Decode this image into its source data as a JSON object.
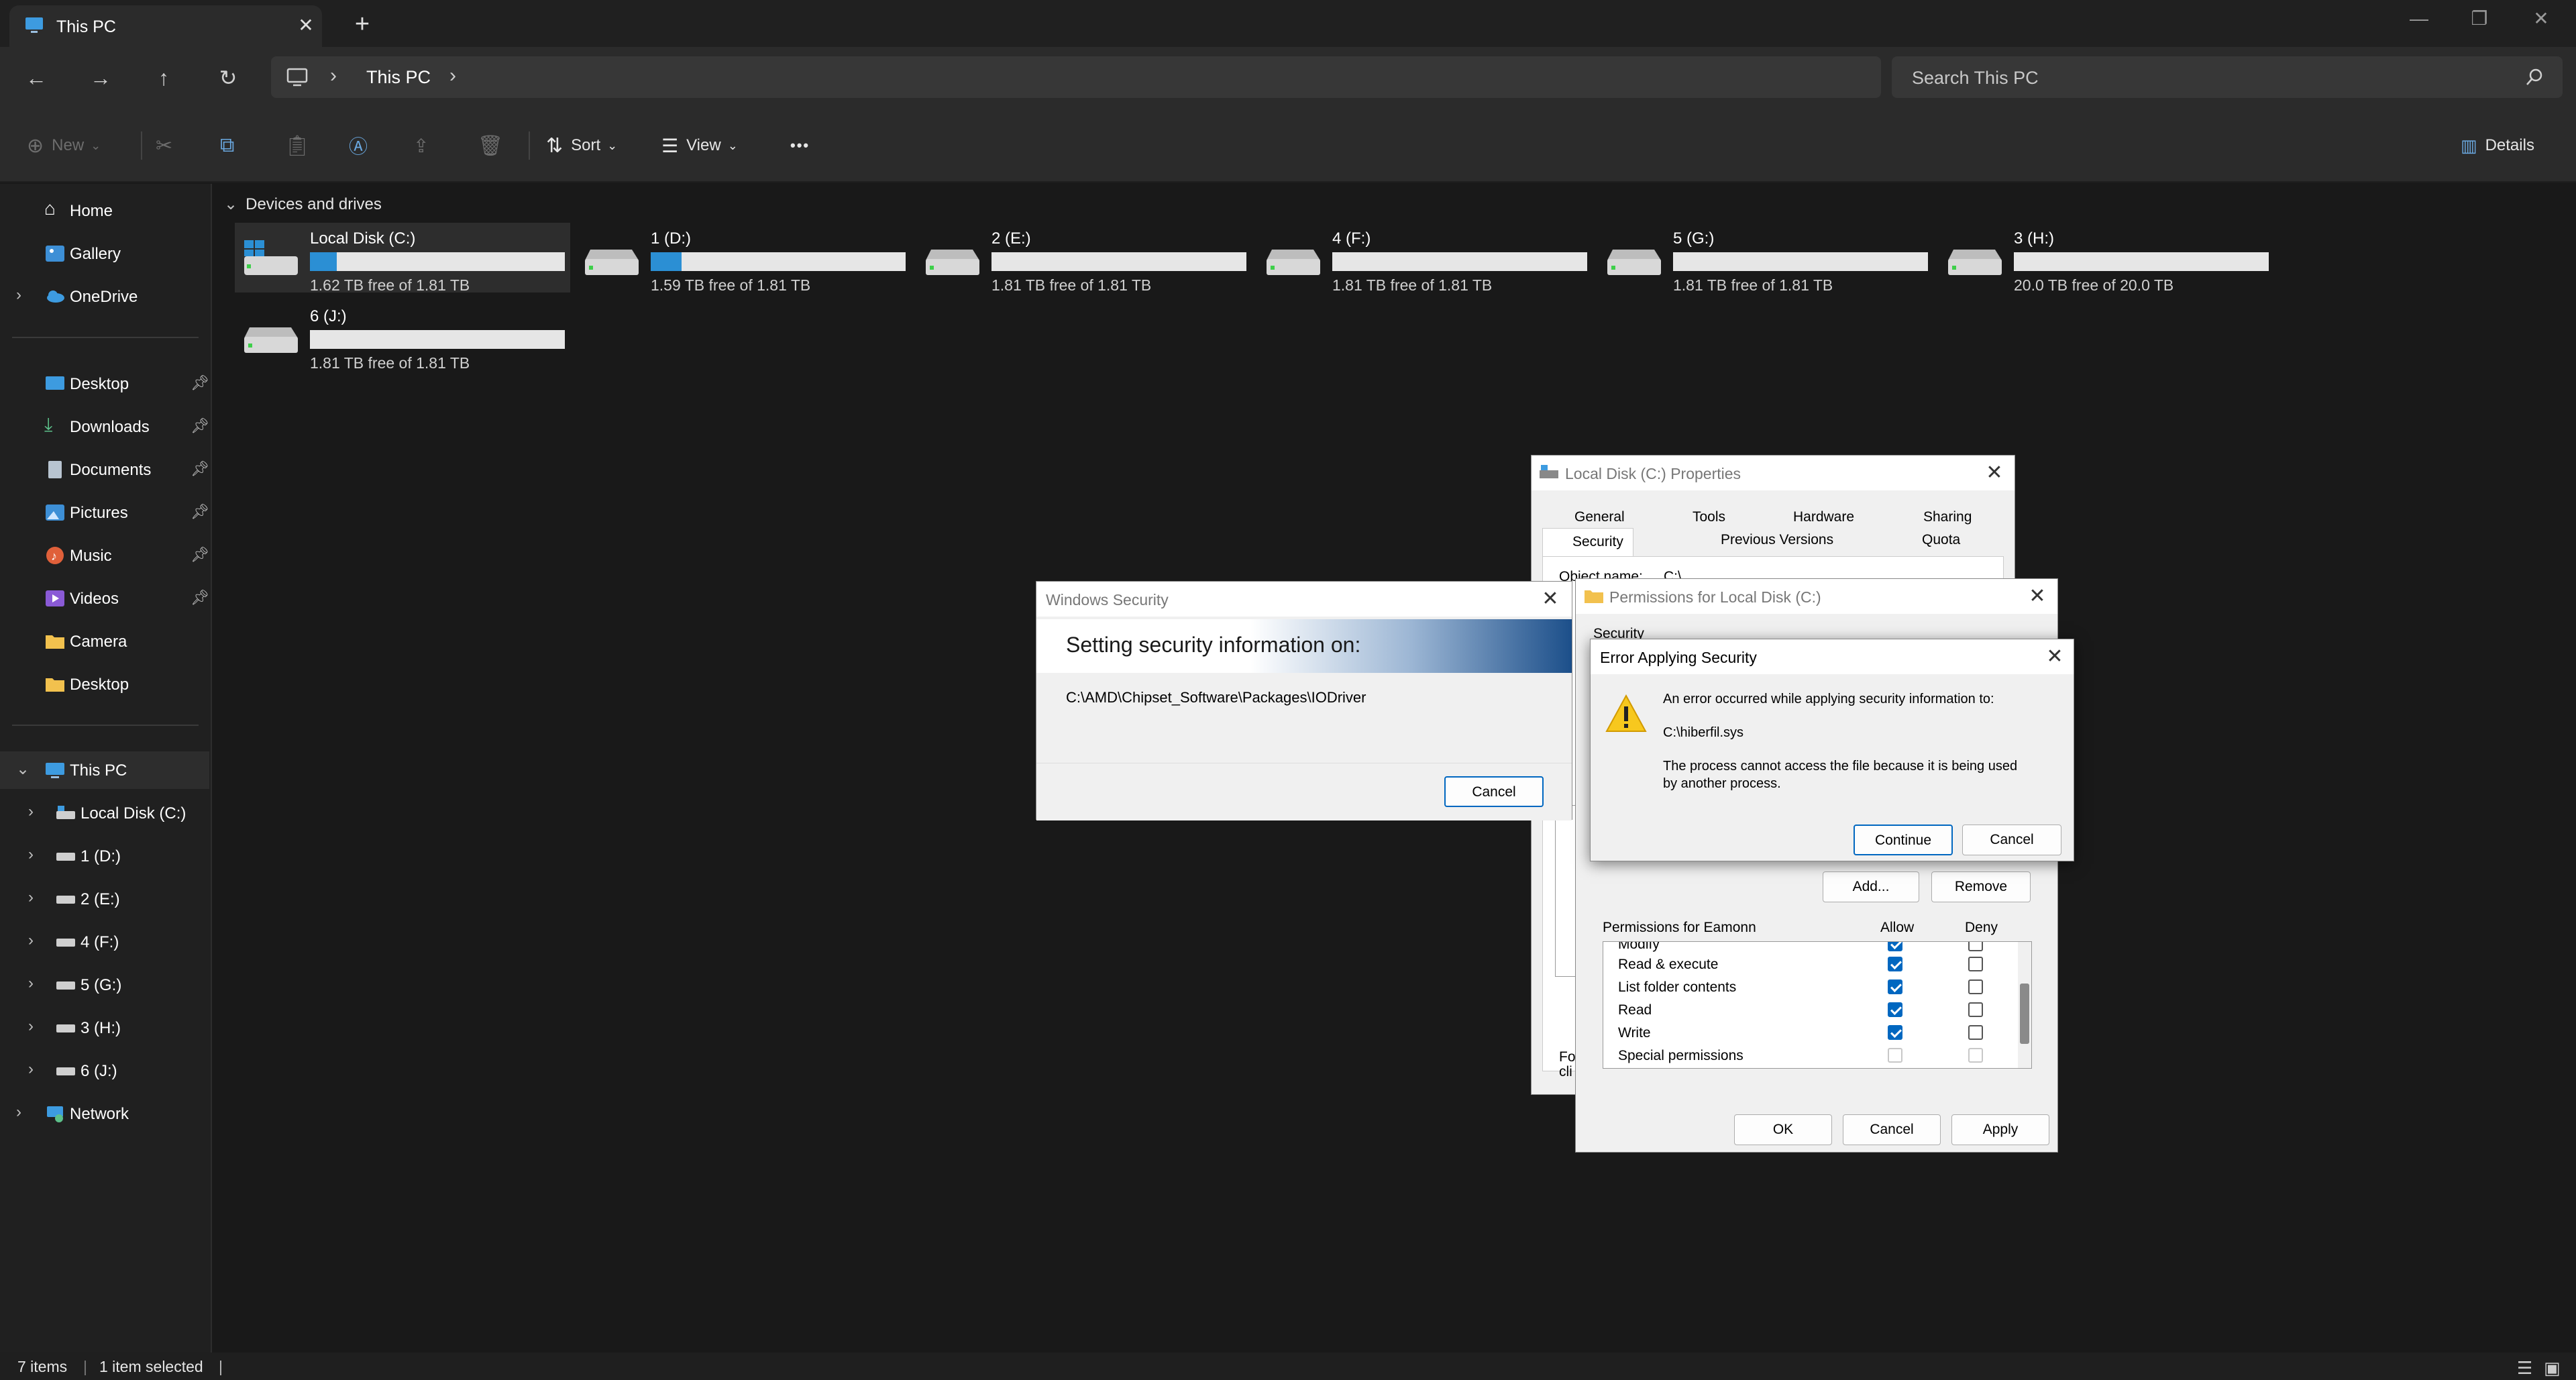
{
  "window": {
    "tab_title": "This PC",
    "new_tab": "+",
    "minimize": "—",
    "restore": "❐",
    "close": "✕"
  },
  "address": {
    "crumb": "This PC",
    "search_placeholder": "Search This PC"
  },
  "toolbar": {
    "new_label": "New",
    "sort_label": "Sort",
    "view_label": "View",
    "more_label": "•••",
    "details_label": "Details"
  },
  "sidebar": {
    "home": "Home",
    "gallery": "Gallery",
    "onedrive": "OneDrive",
    "pinned": [
      {
        "label": "Desktop",
        "icon": "desktop-icon"
      },
      {
        "label": "Downloads",
        "icon": "download-icon"
      },
      {
        "label": "Documents",
        "icon": "document-icon"
      },
      {
        "label": "Pictures",
        "icon": "picture-icon"
      },
      {
        "label": "Music",
        "icon": "music-icon"
      },
      {
        "label": "Videos",
        "icon": "video-icon"
      }
    ],
    "folders": [
      "Camera",
      "Desktop"
    ],
    "this_pc": "This PC",
    "drives": [
      "Local Disk (C:)",
      "1 (D:)",
      "2 (E:)",
      "4 (F:)",
      "5 (G:)",
      "3 (H:)",
      "6 (J:)"
    ],
    "network": "Network"
  },
  "content": {
    "section_title": "Devices and drives",
    "drives": [
      {
        "name": "Local Disk (C:)",
        "free": "1.62 TB free of 1.81 TB",
        "used_fraction": 0.105
      },
      {
        "name": "1 (D:)",
        "free": "1.59 TB free of 1.81 TB",
        "used_fraction": 0.12
      },
      {
        "name": "2 (E:)",
        "free": "1.81 TB free of 1.81 TB",
        "used_fraction": 0
      },
      {
        "name": "4 (F:)",
        "free": "1.81 TB free of 1.81 TB",
        "used_fraction": 0
      },
      {
        "name": "5 (G:)",
        "free": "1.81 TB free of 1.81 TB",
        "used_fraction": 0
      },
      {
        "name": "3 (H:)",
        "free": "20.0 TB free of 20.0 TB",
        "used_fraction": 0
      },
      {
        "name": "6 (J:)",
        "free": "1.81 TB free of 1.81 TB",
        "used_fraction": 0
      }
    ]
  },
  "status": {
    "items": "7 items",
    "selected": "1 item selected"
  },
  "properties_dialog": {
    "title": "Local Disk (C:) Properties",
    "tabs_row1": [
      "General",
      "Tools",
      "Hardware",
      "Sharing"
    ],
    "tabs_row2": [
      "Security",
      "Previous Versions",
      "Quota"
    ],
    "object_name_label": "Object name:",
    "object_name_value": "C:\\",
    "footer_text_1": "Fo",
    "footer_text_2": "cli"
  },
  "permissions_dialog": {
    "title": "Permissions for Local Disk (C:)",
    "security_label": "Security",
    "add_button": "Add...",
    "remove_button": "Remove",
    "perm_header": "Permissions for Eamonn",
    "allow_header": "Allow",
    "deny_header": "Deny",
    "rows": [
      {
        "name": "Modify",
        "allow": true,
        "deny": false,
        "partial": true
      },
      {
        "name": "Read & execute",
        "allow": true,
        "deny": false
      },
      {
        "name": "List folder contents",
        "allow": true,
        "deny": false
      },
      {
        "name": "Read",
        "allow": true,
        "deny": false
      },
      {
        "name": "Write",
        "allow": true,
        "deny": false
      },
      {
        "name": "Special permissions",
        "allow": false,
        "deny": false,
        "disabled": true
      }
    ],
    "ok_button": "OK",
    "cancel_button": "Cancel",
    "apply_button": "Apply"
  },
  "windows_security": {
    "title": "Windows Security",
    "heading": "Setting security information on:",
    "path": "C:\\AMD\\Chipset_Software\\Packages\\IODriver",
    "cancel_button": "Cancel"
  },
  "error_dialog": {
    "title": "Error Applying Security",
    "line1": "An error occurred while applying security information to:",
    "file": "C:\\hiberfil.sys",
    "message_1": "The process cannot access the file because it is being used",
    "message_2": "by another process.",
    "continue_button": "Continue",
    "cancel_button": "Cancel"
  },
  "colors": {
    "accent": "#0067c0",
    "drive_fill": "#2b8fd4",
    "background": "#191919"
  }
}
